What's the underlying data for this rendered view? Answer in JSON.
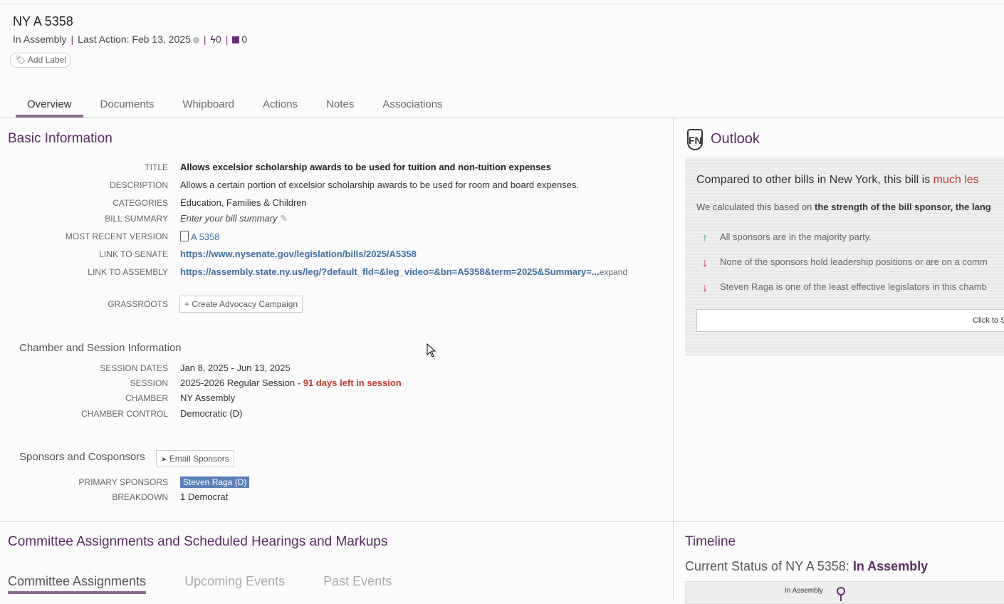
{
  "header": {
    "title": "NY A 5358",
    "status": "In Assembly",
    "last_action": "Last Action: Feb 13, 2025",
    "info_glyph": "i",
    "actions_count": "0",
    "notes_count": "0",
    "add_label": "Add Label"
  },
  "tabs": [
    {
      "label": "Overview"
    },
    {
      "label": "Documents"
    },
    {
      "label": "Whipboard"
    },
    {
      "label": "Actions"
    },
    {
      "label": "Notes"
    },
    {
      "label": "Associations"
    }
  ],
  "basic_info": {
    "heading": "Basic Information",
    "title_label": "TITLE",
    "title_value": "Allows excelsior scholarship awards to be used for tuition and non-tuition expenses",
    "description_label": "DESCRIPTION",
    "description_value": "Allows a certain portion of excelsior scholarship awards to be used for room and board expenses.",
    "categories_label": "CATEGORIES",
    "categories_value": "Education, Families & Children",
    "summary_label": "BILL SUMMARY",
    "summary_value": "Enter your bill summary",
    "version_label": "MOST RECENT VERSION",
    "version_value": "A 5358",
    "senate_label": "LINK TO SENATE",
    "senate_value": "https://www.nysenate.gov/legislation/bills/2025/A5358",
    "assembly_label": "LINK TO ASSEMBLY",
    "assembly_value": "https://assembly.state.ny.us/leg/?default_fld=&leg_video=&bn=A5358&term=2025&Summary=...",
    "assembly_expand": "expand",
    "grassroots_label": "GRASSROOTS",
    "grassroots_button": "+ Create Advocacy Campaign"
  },
  "chamber": {
    "heading": "Chamber and Session Information",
    "dates_label": "SESSION DATES",
    "dates_value": "Jan 8, 2025 - Jun 13, 2025",
    "session_label": "SESSION",
    "session_value": "2025-2026 Regular Session",
    "session_days": " - 91 days left in session",
    "chamber_label": "CHAMBER",
    "chamber_value": "NY Assembly",
    "control_label": "CHAMBER CONTROL",
    "control_value": "Democratic (D)"
  },
  "sponsors": {
    "heading": "Sponsors and Cosponsors",
    "email_button": "Email Sponsors",
    "primary_label": "PRIMARY SPONSORS",
    "primary_value": "Steven Raga (D)",
    "breakdown_label": "BREAKDOWN",
    "breakdown_value": "1 Democrat"
  },
  "outlook": {
    "logo": "FN",
    "title": "Outlook",
    "headline_prefix": "Compared to other bills in New York, this bill is ",
    "headline_highlight": "much les",
    "calc_prefix": "We calculated this based on ",
    "calc_bold": "the strength of the bill sponsor, the lang",
    "items": [
      {
        "arrow": "up",
        "text": "All sponsors are in the majority party."
      },
      {
        "arrow": "down",
        "text": "None of the sponsors hold leadership positions or are on a comm"
      },
      {
        "arrow": "down",
        "text": "Steven Raga is one of the least effective legislators in this chamb"
      }
    ],
    "click_text": "Click to S"
  },
  "committee": {
    "heading": "Committee Assignments and Scheduled Hearings and Markups",
    "tabs": [
      {
        "label": "Committee Assignments"
      },
      {
        "label": "Upcoming Events"
      },
      {
        "label": "Past Events"
      }
    ]
  },
  "timeline": {
    "title": "Timeline",
    "status_prefix": "Current Status of NY A 5358: ",
    "status_value": "In Assembly",
    "marker_label": "In Assembly"
  },
  "colors": {
    "accent_purple": "#5b2a63",
    "link_blue": "#3b6ea5",
    "alert_red": "#c0392b",
    "up_green": "#3aaa55",
    "down_red": "#d02040"
  }
}
